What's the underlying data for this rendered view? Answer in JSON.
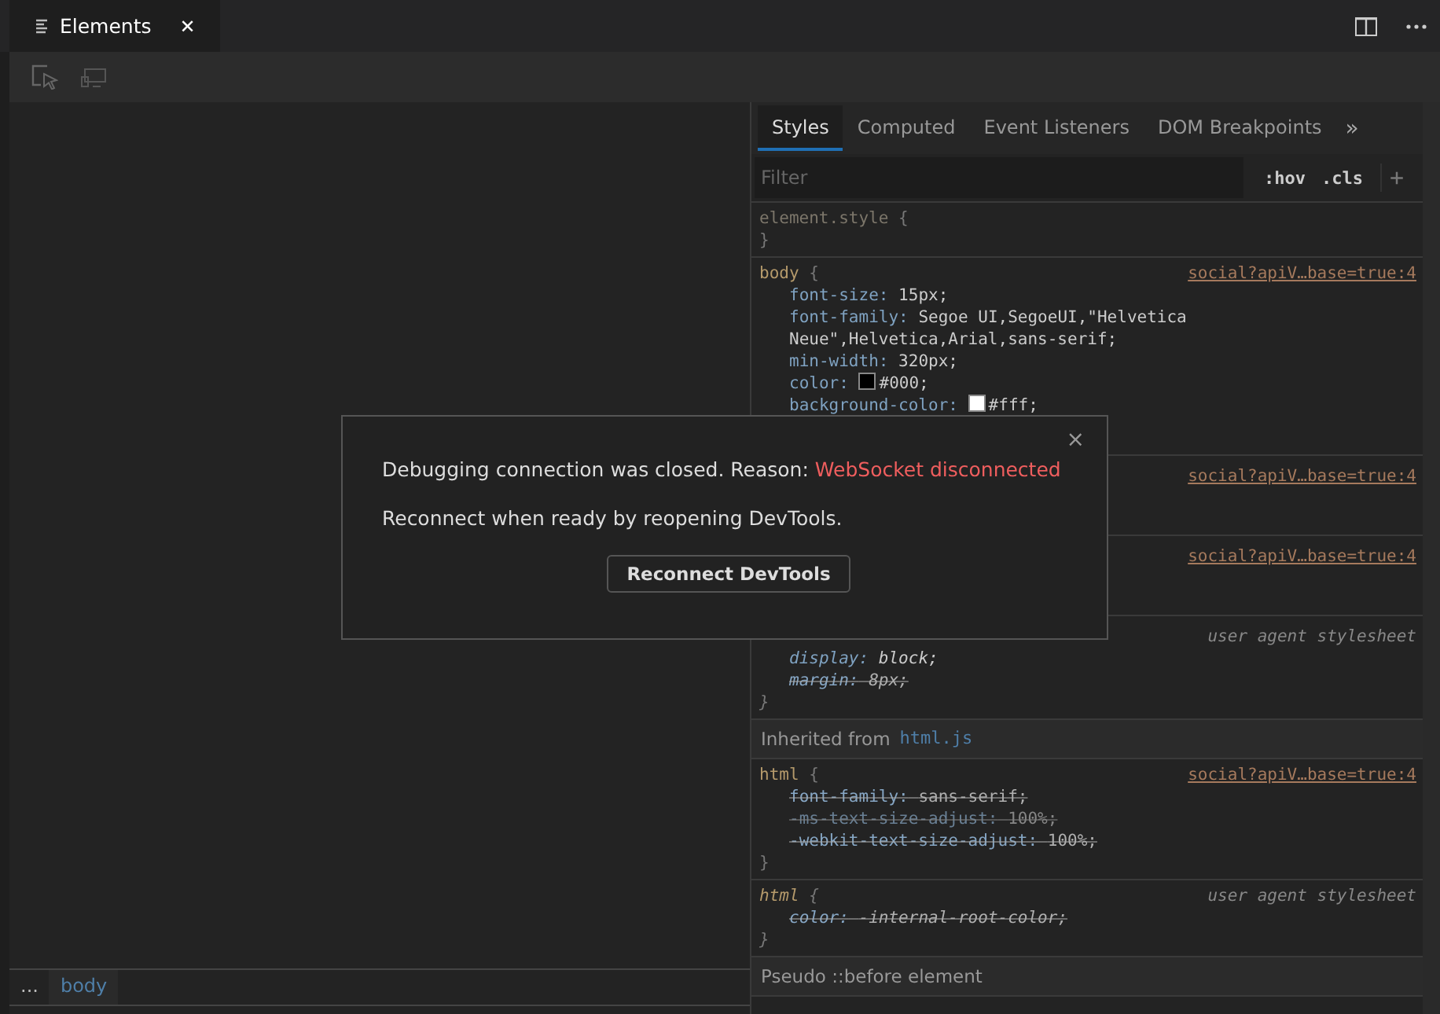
{
  "tab": {
    "label": "Elements",
    "close": "✕"
  },
  "breadcrumb": [
    {
      "label": "...",
      "selected": false
    },
    {
      "label": "body",
      "selected": true
    }
  ],
  "styles_tabs": [
    {
      "label": "Styles",
      "selected": true
    },
    {
      "label": "Computed",
      "selected": false
    },
    {
      "label": "Event Listeners",
      "selected": false
    },
    {
      "label": "DOM Breakpoints",
      "selected": false
    }
  ],
  "more_tabs": "»",
  "filter": {
    "placeholder": "Filter",
    "hov": ":hov",
    "cls": ".cls",
    "add": "+"
  },
  "rules": [
    {
      "kind": "full",
      "selector": "element.style",
      "open": "{",
      "close": "}",
      "user_agent": false,
      "inactive": true
    },
    {
      "kind": "full",
      "selector": "body",
      "open": "{",
      "source": "social?apiV…base=true:4",
      "user_agent": false,
      "inactive": false,
      "props": [
        {
          "name": "font-size:",
          "value": "15px;",
          "struck": false,
          "dim": false
        },
        {
          "name": "font-family:",
          "value": "Segoe UI,SegoeUI,\"Helvetica Neue\",Helvetica,Arial,sans-serif;",
          "struck": false,
          "dim": false
        },
        {
          "name": "min-width:",
          "value": "320px;",
          "struck": false,
          "dim": false
        },
        {
          "name": "color:",
          "value": "#000;",
          "color": "#000000",
          "struck": false,
          "dim": false
        },
        {
          "name": "background-color:",
          "value": "#fff;",
          "color": "#ffffff",
          "struck": false,
          "dim": false
        }
      ]
    },
    {
      "kind": "obscured",
      "source": "social?apiV…base=true:4",
      "user_agent": false
    },
    {
      "kind": "obscured",
      "source": "social?apiV…base=true:4",
      "user_agent": false
    },
    {
      "kind": "obscured",
      "source": "user agent stylesheet",
      "user_agent": true,
      "close": "}",
      "props": [
        {
          "name": "display:",
          "value": "block;",
          "struck": false,
          "dim": false
        },
        {
          "name": "margin:",
          "value": "8px;",
          "struck": true,
          "dim": false
        }
      ]
    },
    {
      "kind": "header",
      "label": "Inherited from",
      "link": "html.js"
    },
    {
      "kind": "full",
      "selector": "html",
      "open": "{",
      "close": "}",
      "source": "social?apiV…base=true:4",
      "user_agent": false,
      "inactive": false,
      "props": [
        {
          "name": "font-family:",
          "value": "sans-serif;",
          "struck": true,
          "dim": false
        },
        {
          "name": "-ms-text-size-adjust:",
          "value": "100%;",
          "struck": true,
          "dim": true
        },
        {
          "name": "-webkit-text-size-adjust:",
          "value": "100%;",
          "struck": true,
          "dim": false
        }
      ]
    },
    {
      "kind": "full",
      "selector": "html",
      "open": "{",
      "close": "}",
      "source": "user agent stylesheet",
      "user_agent": true,
      "inactive": false,
      "props": [
        {
          "name": "color:",
          "value": "-internal-root-color;",
          "struck": true,
          "dim": false
        }
      ]
    },
    {
      "kind": "header",
      "label": "Pseudo ::before element"
    }
  ],
  "dialog": {
    "close": "×",
    "message": "Debugging connection was closed. Reason:",
    "reason": "WebSocket disconnected",
    "hint": "Reconnect when ready by reopening DevTools.",
    "button": "Reconnect DevTools"
  }
}
